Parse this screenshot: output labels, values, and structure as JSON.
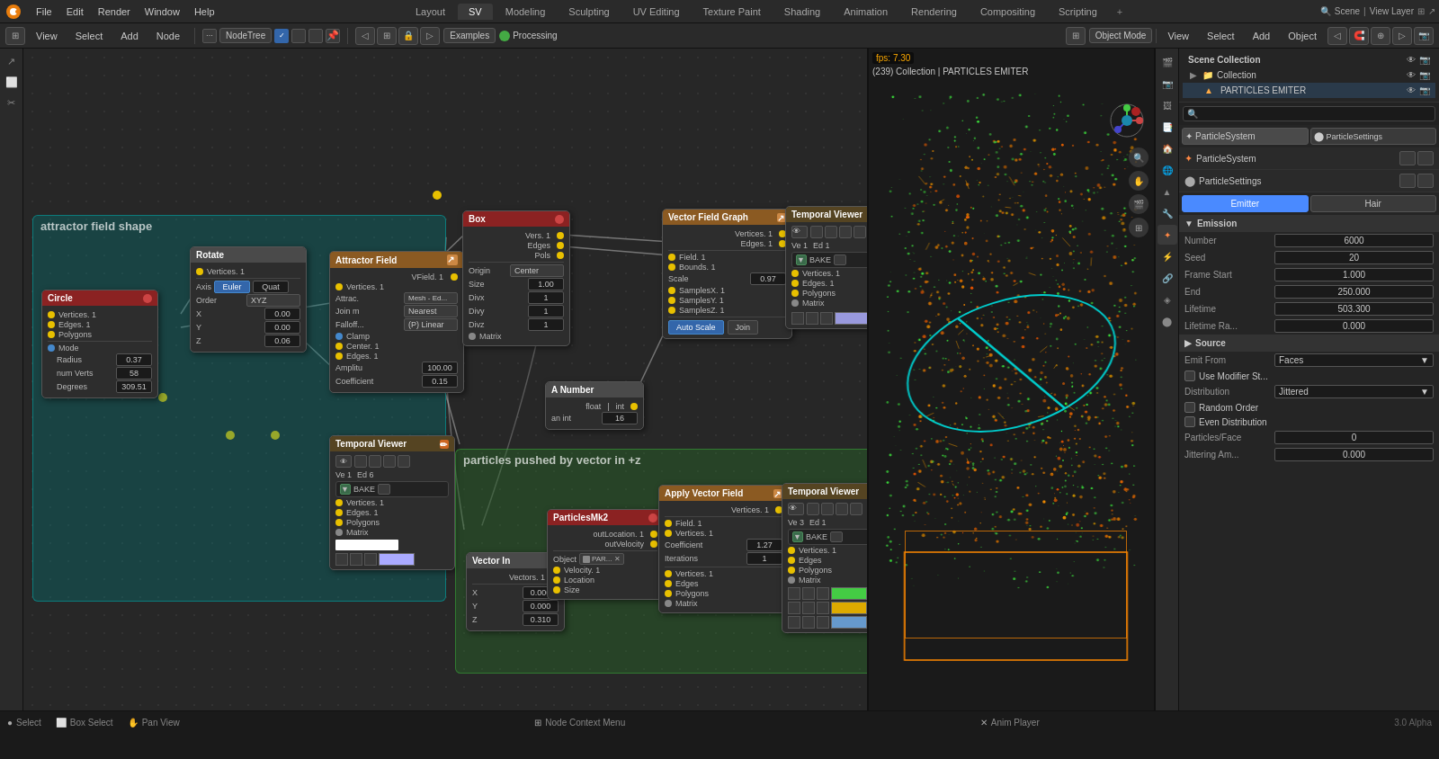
{
  "app": {
    "title": "Blender",
    "version": "3.0 Alpha"
  },
  "menu": {
    "logo": "🔷",
    "items": [
      "File",
      "Edit",
      "Render",
      "Window",
      "Help"
    ]
  },
  "workspace_tabs": {
    "tabs": [
      "Layout",
      "SV",
      "Modeling",
      "Sculpting",
      "UV Editing",
      "Texture Paint",
      "Shading",
      "Animation",
      "Rendering",
      "Compositing",
      "Scripting"
    ],
    "active": "SV",
    "add_icon": "+"
  },
  "editor_toolbar": {
    "view_label": "View",
    "select_label": "Select",
    "add_label": "Add",
    "node_label": "Node",
    "nodetree_label": "NodeTree",
    "examples_label": "Examples",
    "processing_label": "Processing"
  },
  "viewport_toolbar": {
    "object_mode": "Object Mode",
    "view_label": "View",
    "select_label": "Select",
    "add_label": "Add",
    "object_label": "Object"
  },
  "fps": {
    "value": "fps: 7.30",
    "collection": "(239) Collection | PARTICLES EMITER"
  },
  "nodes": {
    "attractor_group_label": "attractor field shape",
    "particles_group_label": "particles pushed by vector in +z",
    "circle_node": {
      "title": "Circle",
      "vertices": "Vertices. 1",
      "edges": "Edges. 1",
      "polygons": "Polygons",
      "mode": "Mode",
      "radius": "Radius",
      "radius_val": "0.37",
      "num_verts": "num Verts",
      "num_verts_val": "58",
      "degrees": "Degrees",
      "degrees_val": "309.51"
    },
    "rotate_node": {
      "title": "Rotate",
      "vertices": "Vertices. 1",
      "axis": "Axis",
      "euler": "Euler",
      "quat": "Quat",
      "order": "Order",
      "order_val": "XYZ",
      "x": "X",
      "x_val": "0.00",
      "y": "Y",
      "y_val": "0.00",
      "z": "Z",
      "z_val": "0.06"
    },
    "attractor_field_node": {
      "title": "Attractor Field",
      "vfield": "VField. 1",
      "vertices": "Vertices. 1",
      "attrac": "Attrac.",
      "attrac_val": "Mesh - Ed...",
      "join_m": "Join m",
      "join_val": "Nearest",
      "falloff": "Falloff...",
      "falloff_val": "(P) Linear",
      "clamp": "Clamp",
      "center": "Center. 1",
      "edges": "Edges. 1",
      "amplitu": "Amplitu",
      "amplitu_val": "100.00",
      "coefficient": "Coefficient",
      "coefficient_val": "0.15"
    },
    "temporal_viewer_1": {
      "title": "Temporal Viewer",
      "ve": "Ve  1",
      "ed": "Ed  6",
      "vertices": "Vertices. 1",
      "edges": "Edges. 1",
      "polygons": "Polygons",
      "matrix": "Matrix"
    },
    "temporal_viewer_2": {
      "title": "Temporal Viewer",
      "ve": "Ve  1",
      "ed": "Ed  1",
      "vertices": "Vertices. 1",
      "edges": "Edges. 1",
      "polygons": "Polygons",
      "matrix": "Matrix"
    },
    "temporal_viewer_3": {
      "title": "Temporal Viewer",
      "ve": "Ve  3",
      "ed": "Ed  1",
      "vertices": "Vertices. 1",
      "edges": "Edges",
      "polygons": "Polygons",
      "matrix": "Matrix"
    },
    "box_node": {
      "title": "Box",
      "vertices": "Vers. 1",
      "edges": "Edges",
      "pols": "Pols",
      "origin": "Origin",
      "origin_val": "Center",
      "size": "Size",
      "size_val": "1.00",
      "divx": "Divx",
      "divx_val": "1",
      "divy": "Divy",
      "divy_val": "1",
      "divz": "Divz",
      "divz_val": "1",
      "matrix": "Matrix"
    },
    "vector_field_graph": {
      "title": "Vector Field Graph",
      "vertices": "Vertices. 1",
      "edges": "Edges. 1",
      "field": "Field. 1",
      "bounds": "Bounds. 1",
      "scale": "Scale",
      "scale_val": "0.97",
      "samplesx": "SamplesX. 1",
      "samplesy": "SamplesY. 1",
      "samplesz": "SamplesZ. 1",
      "auto_scale": "Auto Scale",
      "join": "Join"
    },
    "a_number_node": {
      "title": "A Number",
      "float": "float",
      "int_label": "int",
      "an_int": "an int",
      "an_int_val": "16"
    },
    "vector_in_node": {
      "title": "Vector In",
      "vectors": "Vectors. 1",
      "x": "X",
      "x_val": "0.000",
      "y": "Y",
      "y_val": "0.000",
      "z": "Z",
      "z_val": "0.310"
    },
    "particles_mk2_node": {
      "title": "ParticlesMk2",
      "outlocation": "outLocation. 1",
      "outvelocity": "outVelocity",
      "object": "Object",
      "object_val": "PAR...",
      "velocity": "Velocity. 1",
      "location": "Location",
      "size": "Size"
    },
    "apply_vector_field": {
      "title": "Apply Vector Field",
      "vertices": "Vertices. 1",
      "field": "Field. 1",
      "vertices2": "Vertices. 1",
      "coefficient": "Coefficient",
      "coefficient_val": "1.27",
      "iterations": "Iterations",
      "iterations_val": "1",
      "vertices_out": "Vertices. 1",
      "edges_out": "Edges",
      "polygons_out": "Polygons",
      "matrix_out": "Matrix"
    }
  },
  "scene_collection": {
    "title": "Scene Collection",
    "collection": "Collection",
    "particles_emiter": "PARTICLES EMITER"
  },
  "particle_settings": {
    "header": "ParticleSystem",
    "settings_label": "ParticleSettings",
    "emitter_tab": "Emitter",
    "hair_tab": "Hair",
    "emission_section": "Emission",
    "number_label": "Number",
    "number_val": "6000",
    "seed_label": "Seed",
    "seed_val": "20",
    "frame_start_label": "Frame Start",
    "frame_start_val": "1.000",
    "end_label": "End",
    "end_val": "250.000",
    "lifetime_label": "Lifetime",
    "lifetime_val": "503.300",
    "lifetime_ra_label": "Lifetime Ra...",
    "lifetime_ra_val": "0.000",
    "source_section": "Source",
    "emit_from_label": "Emit From",
    "emit_from_val": "Faces",
    "use_modifier_st": "Use Modifier St...",
    "distribution_label": "Distribution",
    "distribution_val": "Jittered",
    "random_order": "Random Order",
    "even_distribution": "Even Distribution",
    "particles_face_label": "Particles/Face",
    "particles_face_val": "0",
    "jittering_am_label": "Jittering Am...",
    "jittering_am_val": "0.000"
  },
  "status_bar": {
    "select": "Select",
    "box_select": "Box Select",
    "pan_view": "Pan View",
    "node_context_menu": "Node Context Menu",
    "anim_player": "Anim Player",
    "version": "3.0 Alpha"
  }
}
